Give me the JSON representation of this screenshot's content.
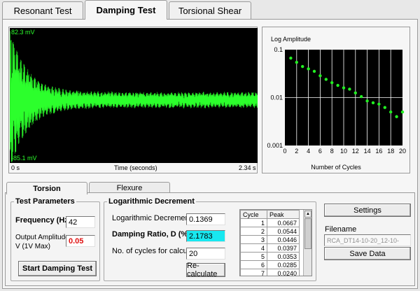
{
  "tabs": [
    {
      "label": "Resonant Test",
      "active": false
    },
    {
      "label": "Damping Test",
      "active": true
    },
    {
      "label": "Torsional Shear",
      "active": false
    }
  ],
  "scope": {
    "top_label": "82.3 mV",
    "bottom_label": "-85.1 mV",
    "x_start": "0 s",
    "x_end": "2.34 s",
    "x_label": "Time (seconds)",
    "trace_color": "#2cff2c"
  },
  "chart_data": {
    "type": "scatter",
    "title": "Log Amplitude",
    "xlabel": "Number of Cycles",
    "ylabel": "",
    "x_ticks": [
      "0",
      "2",
      "4",
      "6",
      "8",
      "10",
      "12",
      "14",
      "16",
      "18",
      "20"
    ],
    "y_ticks": [
      "0.1",
      "0.01",
      "0.001"
    ],
    "xlim": [
      0,
      20
    ],
    "ylim": [
      0.001,
      0.1
    ],
    "log_y": true,
    "grid": true,
    "point_color": "#22ee22",
    "x": [
      1,
      2,
      3,
      4,
      5,
      6,
      7,
      8,
      9,
      10,
      11,
      12,
      13,
      14,
      15,
      16,
      17,
      18,
      19,
      20
    ],
    "y": [
      0.0667,
      0.0544,
      0.0446,
      0.0397,
      0.0353,
      0.0285,
      0.024,
      0.0205,
      0.018,
      0.016,
      0.015,
      0.0125,
      0.0105,
      0.0085,
      0.0078,
      0.0073,
      0.0062,
      0.005,
      0.004,
      0.005
    ]
  },
  "subtabs": [
    {
      "label": "Torsion",
      "active": true
    },
    {
      "label": "Flexure",
      "active": false
    }
  ],
  "test_params": {
    "legend": "Test Parameters",
    "frequency_label": "Frequency (Hz)",
    "frequency_value": "42",
    "amplitude_label_1": "Output Amplitude",
    "amplitude_label_2": "V (1V Max)",
    "amplitude_value": "0.05",
    "start_button": "Start Damping Test"
  },
  "log_dec": {
    "legend": "Logarithmic Decrement",
    "decrement_label": "Logarithmic Decrement, d",
    "decrement_value": "0.1369",
    "damping_label": "Damping Ratio, D (%)",
    "damping_value": "2.1783",
    "cycles_label": "No. of cycles for calculation",
    "cycles_value": "20",
    "recalc_button": "Re-calculate"
  },
  "peak_table": {
    "headers": [
      "Cycle",
      "Peak"
    ],
    "rows": [
      {
        "cycle": "1",
        "peak": "0.0667"
      },
      {
        "cycle": "2",
        "peak": "0.0544"
      },
      {
        "cycle": "3",
        "peak": "0.0446"
      },
      {
        "cycle": "4",
        "peak": "0.0397"
      },
      {
        "cycle": "5",
        "peak": "0.0353"
      },
      {
        "cycle": "6",
        "peak": "0.0285"
      },
      {
        "cycle": "7",
        "peak": "0.0240"
      }
    ]
  },
  "side": {
    "settings_button": "Settings",
    "filename_label": "Filename",
    "filename_value": "RCA_DT14-10-20_12-10-5.dtt",
    "save_button": "Save Data"
  }
}
